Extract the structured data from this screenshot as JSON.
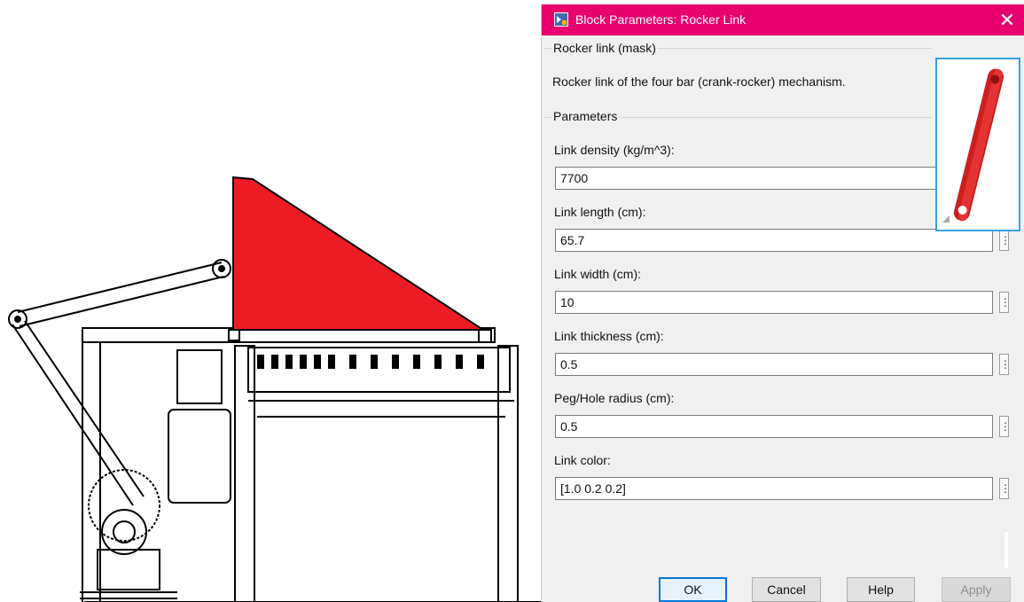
{
  "dialog": {
    "title": "Block Parameters: Rocker Link",
    "close_glyph": "✕",
    "mask_group": "Rocker link (mask)",
    "description": "Rocker link of the four bar (crank-rocker) mechanism.",
    "params_group": "Parameters",
    "fields": [
      {
        "label": "Link density (kg/m^3):",
        "value": "7700"
      },
      {
        "label": "Link length (cm):",
        "value": "65.7"
      },
      {
        "label": "Link width (cm):",
        "value": "10"
      },
      {
        "label": "Link thickness (cm):",
        "value": "0.5"
      },
      {
        "label": "Peg/Hole radius (cm):",
        "value": "0.5"
      },
      {
        "label": "Link color:",
        "value": "[1.0 0.2 0.2]"
      }
    ],
    "field_menu_glyph": "⋮",
    "buttons": {
      "ok": "OK",
      "cancel": "Cancel",
      "help": "Help",
      "apply": "Apply"
    }
  },
  "colors": {
    "titlebar": "#e8006e",
    "link_red": "#ed1c24",
    "accent": "#0078d7"
  }
}
